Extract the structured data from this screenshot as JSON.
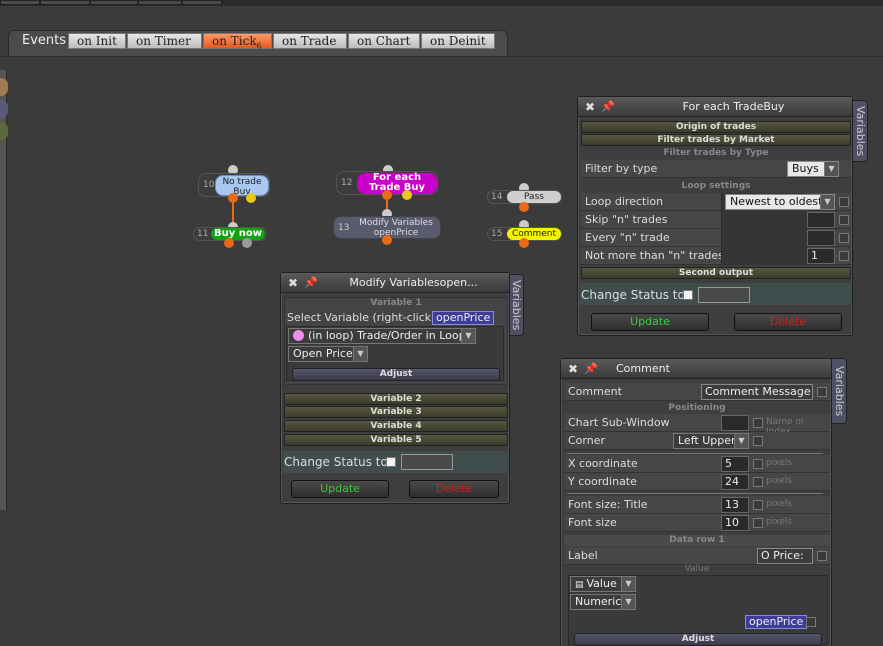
{
  "tabs": {
    "events_label": "Events",
    "items": [
      {
        "label": "on Init"
      },
      {
        "label": "on Timer"
      },
      {
        "label": "on Tick",
        "count": "6"
      },
      {
        "label": "on Trade"
      },
      {
        "label": "on Chart"
      },
      {
        "label": "on Deinit"
      }
    ],
    "active_index": 2,
    "active_color": "#e55a1c"
  },
  "nodes": {
    "n10": {
      "num": "10",
      "label": "No trade Buy",
      "color": "#a8c8f0"
    },
    "n11": {
      "num": "11",
      "label": "Buy now",
      "color": "#12a212"
    },
    "n12": {
      "num": "12",
      "label": "For each Trade Buy",
      "color": "#c800c8"
    },
    "n13": {
      "num": "13",
      "label": "Modify Variables openPrice",
      "color": "#5a5a6e"
    },
    "n14": {
      "num": "14",
      "label": "Pass",
      "color": "#cfcfcf"
    },
    "n15": {
      "num": "15",
      "label": "Comment",
      "color": "#f4f400"
    }
  },
  "foreach_panel": {
    "title": "For each TradeBuy",
    "side_tab": "Variables",
    "origin_section": "Origin of trades",
    "filter_market_section": "Filter trades by Market",
    "filter_type_sub": "Filter trades by Type",
    "filter_by_type_label": "Filter by type",
    "filter_by_type_value": "Buys",
    "loop_settings_sub": "Loop settings",
    "loop_direction_label": "Loop direction",
    "loop_direction_value": "Newest to oldest",
    "skip_label": "Skip \"n\" trades",
    "every_label": "Every \"n\" trade",
    "not_more_label": "Not more than \"n\" trades",
    "not_more_value": "1",
    "second_output_section": "Second output",
    "change_status_label": "Change Status to",
    "update_label": "Update",
    "delete_label": "Delete"
  },
  "modify_panel": {
    "title": "Modify Variablesopen...",
    "side_tab": "Variables",
    "variable1_sub": "Variable 1",
    "select_variable_label": "Select Variable (right-click)",
    "variable_tag": "openPrice",
    "source_value": "(in loop) Trade/Order in Loop",
    "field_value": "Open Price",
    "adjust_label": "Adjust",
    "variable2": "Variable 2",
    "variable3": "Variable 3",
    "variable4": "Variable 4",
    "variable5": "Variable 5",
    "change_status_label": "Change Status to",
    "update_label": "Update",
    "delete_label": "Delete"
  },
  "comment_panel": {
    "title": "Comment",
    "side_tab": "Variables",
    "comment_label": "Comment",
    "comment_value": "Comment Message",
    "positioning_sub": "Positioning",
    "chart_subwindow_label": "Chart Sub-Window",
    "name_or_index": "Name or Index",
    "corner_label": "Corner",
    "corner_value": "Left Upper",
    "x_label": "X coordinate",
    "x_value": "5",
    "y_label": "Y coordinate",
    "y_value": "24",
    "pixels": "pixels",
    "font_title_label": "Font size: Title",
    "font_title_value": "13",
    "font_size_label": "Font size",
    "font_size_value": "10",
    "data_row_sub": "Data row 1",
    "label_label": "Label",
    "label_value": "O Price:",
    "value_sub": "Value",
    "value_type": "Value",
    "numeric_value": "Numeric",
    "variable_tag": "openPrice",
    "adjust_label": "Adjust"
  }
}
